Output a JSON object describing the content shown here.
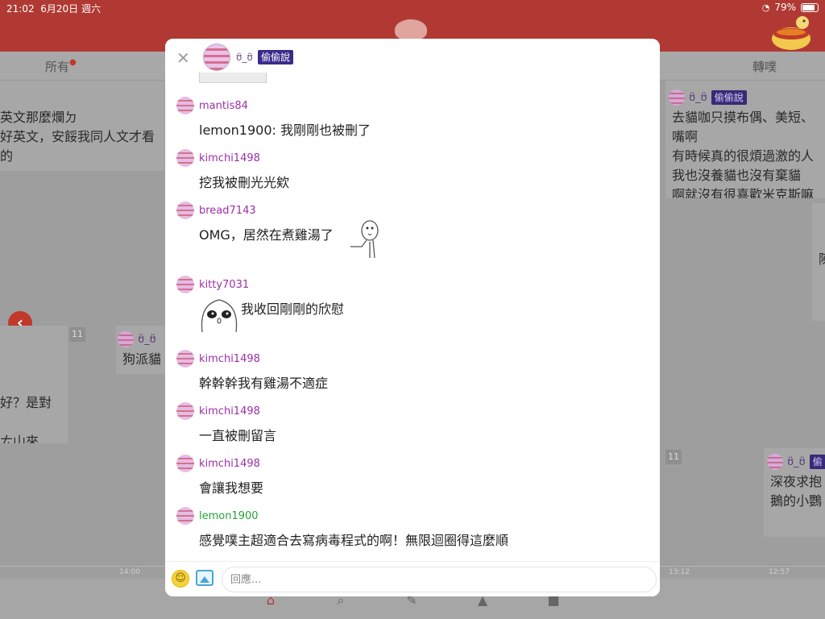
{
  "status_bar": {
    "time": "21:02",
    "date": "6月20日 週六",
    "battery": "79%"
  },
  "tabs": {
    "all": "所有",
    "share": "轉噗"
  },
  "background": {
    "left_top_lines": [
      "英文那麼爛ㄉ",
      "好英文，安餒我同人文才看的"
    ],
    "left_mid_lines": [
      "好？是對",
      "ㄊ山來"
    ],
    "dog_text": "狗派貓",
    "right_top_nick": "ʊ̈_ʊ̈",
    "right_top_badge": "偷偷說",
    "right_top_lines": [
      "去貓咖只摸布偶、美短、",
      "嘴啊",
      "有時候真的很煩過激的人",
      "我也沒養貓也沒有棄貓",
      "啊就沒有很喜歡米克斯嘛"
    ],
    "right_bottom_nick": "ʊ̈_ʊ̈",
    "right_bottom_badge": "偷",
    "right_bottom_lines": [
      "深夜求抱",
      "鵝的小鸚"
    ],
    "right_mid_char": "陳",
    "dog_nick": "ʊ̈_ʊ̈",
    "count_left": "11",
    "count_right": "11",
    "timeline": [
      "14:00",
      "13:12",
      "12:57"
    ]
  },
  "modal": {
    "poster_nick": "ʊ̈_ʊ̈",
    "poster_badge": "偷偷說",
    "comments": [
      {
        "user": "mantis84",
        "text": "lemon1900: 我剛剛也被刪了"
      },
      {
        "user": "kimchi1498",
        "text": "挖我被刪光光欸"
      },
      {
        "user": "bread7143",
        "text": "OMG，居然在煮雞湯了"
      },
      {
        "user": "kitty7031",
        "text": "我收回剛剛的欣慰"
      },
      {
        "user": "kimchi1498",
        "text": "幹幹幹我有雞湯不適症"
      },
      {
        "user": "kimchi1498",
        "text": "一直被刪留言"
      },
      {
        "user": "kimchi1498",
        "text": "會讓我想要"
      },
      {
        "user": "lemon1900",
        "text": "感覺噗主超適合去寫病毒程式的啊！無限迴圈得這麼順"
      }
    ],
    "reply_placeholder": "回應..."
  },
  "colors": {
    "brand": "#b03a33",
    "username": "#9b2fa8",
    "username_op": "#27a23a",
    "badge": "#3a2a8a"
  },
  "icons": [
    "close-icon",
    "emoji-icon",
    "image-icon",
    "back-arrow-icon",
    "home-icon",
    "search-icon",
    "edit-icon",
    "bell-icon",
    "profile-icon",
    "wifi-icon",
    "battery-icon"
  ]
}
